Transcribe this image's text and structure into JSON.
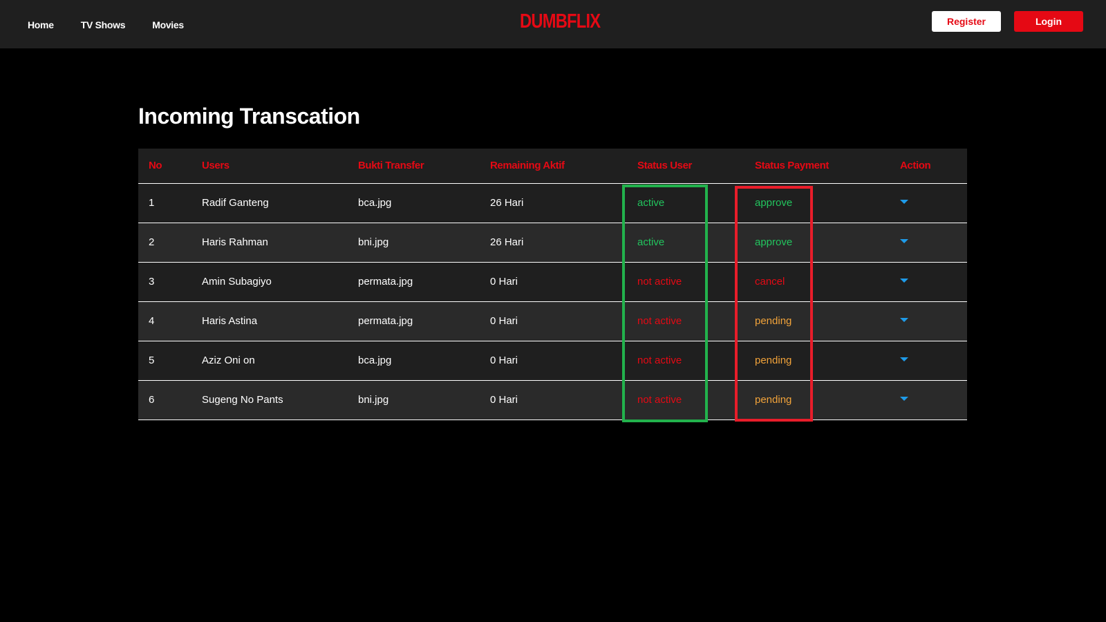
{
  "nav": {
    "links": [
      "Home",
      "TV Shows",
      "Movies"
    ],
    "brand": "DUMBFLIX",
    "register_label": "Register",
    "login_label": "Login"
  },
  "page": {
    "title": "Incoming Transcation"
  },
  "table": {
    "headers": [
      "No",
      "Users",
      "Bukti Transfer",
      "Remaining Aktif",
      "Status User",
      "Status Payment",
      "Action"
    ],
    "rows": [
      {
        "no": "1",
        "user": "Radif Ganteng",
        "file": "bca.jpg",
        "remaining": "26 Hari",
        "status_user": "active",
        "status_payment": "approve"
      },
      {
        "no": "2",
        "user": "Haris Rahman",
        "file": "bni.jpg",
        "remaining": "26 Hari",
        "status_user": "active",
        "status_payment": "approve"
      },
      {
        "no": "3",
        "user": "Amin Subagiyo",
        "file": "permata.jpg",
        "remaining": "0 Hari",
        "status_user": "not active",
        "status_payment": "cancel"
      },
      {
        "no": "4",
        "user": "Haris Astina",
        "file": "permata.jpg",
        "remaining": "0 Hari",
        "status_user": "not active",
        "status_payment": "pending"
      },
      {
        "no": "5",
        "user": "Aziz Oni on",
        "file": "bca.jpg",
        "remaining": "0 Hari",
        "status_user": "not active",
        "status_payment": "pending"
      },
      {
        "no": "6",
        "user": "Sugeng No Pants",
        "file": "bni.jpg",
        "remaining": "0 Hari",
        "status_user": "not active",
        "status_payment": "pending"
      }
    ]
  },
  "colors": {
    "accent": "#e50914",
    "active": "#22c55e",
    "pending": "#f2a33a",
    "caret": "#1e9be9",
    "highlight_green": "#22b24c",
    "highlight_red": "#e81d2a"
  }
}
